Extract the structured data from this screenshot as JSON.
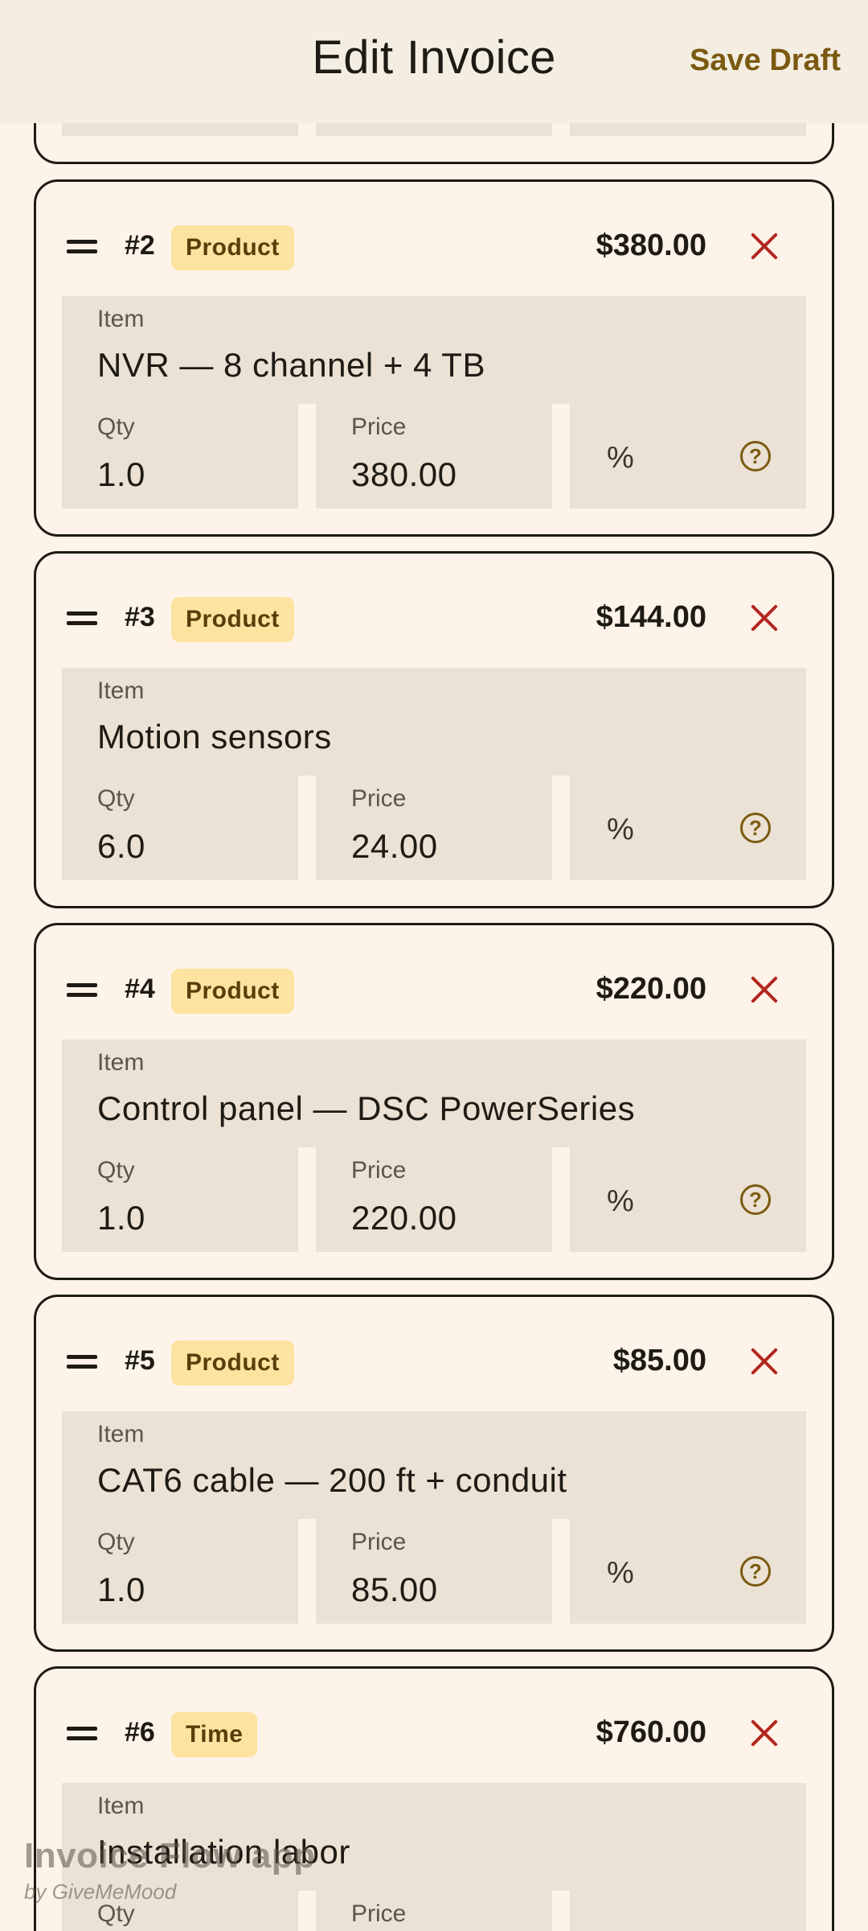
{
  "header": {
    "title": "Edit Invoice",
    "save_label": "Save Draft"
  },
  "labels": {
    "item": "Item",
    "qty": "Qty",
    "price": "Price",
    "discount_unit": "%"
  },
  "lines": [
    {
      "number": "#2",
      "type": "Product",
      "amount": "$380.00",
      "item": "NVR — 8 channel + 4 TB",
      "qty": "1.0",
      "price": "380.00"
    },
    {
      "number": "#3",
      "type": "Product",
      "amount": "$144.00",
      "item": "Motion sensors",
      "qty": "6.0",
      "price": "24.00"
    },
    {
      "number": "#4",
      "type": "Product",
      "amount": "$220.00",
      "item": "Control panel — DSC PowerSeries",
      "qty": "1.0",
      "price": "220.00"
    },
    {
      "number": "#5",
      "type": "Product",
      "amount": "$85.00",
      "item": "CAT6 cable — 200 ft + conduit",
      "qty": "1.0",
      "price": "85.00"
    },
    {
      "number": "#6",
      "type": "Time",
      "amount": "$760.00",
      "item": "Installation labor",
      "qty": "",
      "price": ""
    }
  ],
  "watermark": {
    "app": "Invoice Flow app",
    "by": "by GiveMeMood"
  },
  "colors": {
    "background": "#fdf3e8",
    "accent": "#7a5a10",
    "badge": "#fde3a0",
    "delete": "#b3261e"
  }
}
